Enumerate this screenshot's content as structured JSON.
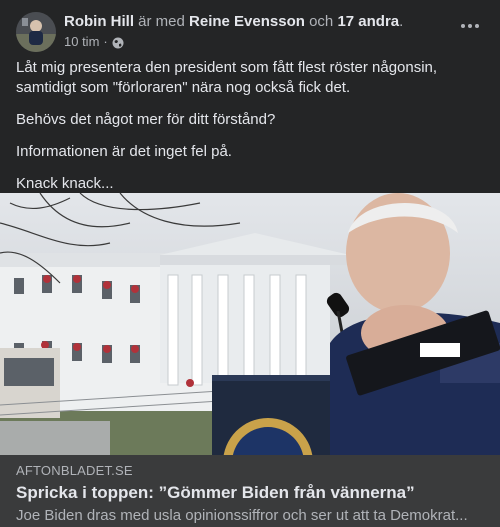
{
  "post": {
    "author": "Robin Hill",
    "with_text": "är med",
    "tagged": "Reine Evensson",
    "and_text": "och",
    "others": "17 andra",
    "period": ".",
    "time": "10 tim",
    "dot": "·",
    "privacy_icon": "globe-icon",
    "more_icon": "more-options-icon",
    "paragraphs": [
      "Låt mig presentera den president som fått flest röster någonsin, samtidigt som \"förloraren\" nära nog också fick det.",
      "Behövs det något mer för ditt förstånd?",
      "Informationen är det inget fel på.",
      "Knack knack..."
    ]
  },
  "link_preview": {
    "domain": "AFTONBLADET.SE",
    "headline": "Spricka i toppen: ”Gömmer Biden från vännerna”",
    "description": "Joe Biden dras med usla opinionssiffror och ser ut att ta Demokrat..."
  },
  "colors": {
    "background": "#242526",
    "text_primary": "#e4e6eb",
    "text_secondary": "#b0b3b8",
    "link_box": "#3a3b3c"
  }
}
